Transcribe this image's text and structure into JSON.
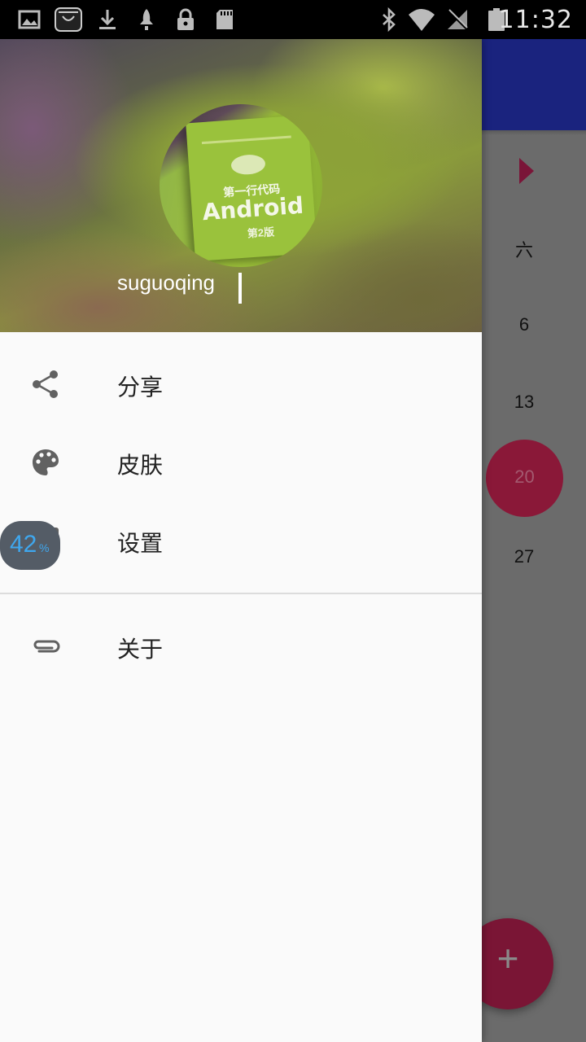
{
  "status_bar": {
    "time": "11:32",
    "left_icons": [
      "image-icon",
      "store-icon",
      "download-icon",
      "rocket-icon",
      "lock-icon",
      "sd-card-icon"
    ],
    "right_icons": [
      "bluetooth-icon",
      "wifi-icon",
      "no-signal-icon",
      "battery-icon"
    ]
  },
  "drawer": {
    "username": "suguoqing",
    "avatar_book": {
      "title": "第一行代码",
      "name": "Android",
      "edition": "第2版"
    },
    "menu": [
      {
        "label": "分享",
        "icon": "share-icon"
      },
      {
        "label": "皮肤",
        "icon": "palette-icon"
      },
      {
        "label": "设置",
        "icon": "settings-icon"
      },
      {
        "label": "关于",
        "icon": "paperclip-icon"
      }
    ]
  },
  "background_calendar": {
    "weekday_header": "六",
    "dates": [
      "6",
      "13",
      "20",
      "27"
    ],
    "today": "20",
    "fab_label": "+"
  },
  "overlay": {
    "battery_value": "42",
    "battery_unit": "%"
  },
  "colors": {
    "toolbar": "#1a237e",
    "accent": "#c2185b",
    "icon_grey": "#616161"
  }
}
